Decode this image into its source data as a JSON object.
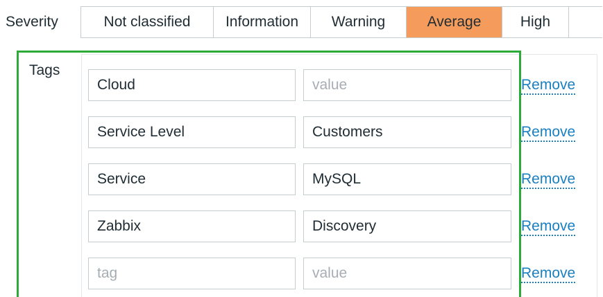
{
  "severity": {
    "label": "Severity",
    "options": [
      {
        "label": "Not classified",
        "selected": false
      },
      {
        "label": "Information",
        "selected": false
      },
      {
        "label": "Warning",
        "selected": false
      },
      {
        "label": "Average",
        "selected": true
      },
      {
        "label": "High",
        "selected": false
      },
      {
        "label": "",
        "selected": false
      }
    ],
    "selected_color": "#f59b5c"
  },
  "tags": {
    "label": "Tags",
    "highlight_color": "#2eaa38",
    "remove_label": "Remove",
    "rows": [
      {
        "tag": "Cloud",
        "tag_placeholder": "tag",
        "value": "",
        "value_placeholder": "value"
      },
      {
        "tag": "Service Level",
        "tag_placeholder": "tag",
        "value": "Customers",
        "value_placeholder": "value"
      },
      {
        "tag": "Service",
        "tag_placeholder": "tag",
        "value": "MySQL",
        "value_placeholder": "value"
      },
      {
        "tag": "Zabbix",
        "tag_placeholder": "tag",
        "value": "Discovery",
        "value_placeholder": "value"
      },
      {
        "tag": "",
        "tag_placeholder": "tag",
        "value": "",
        "value_placeholder": "value"
      }
    ]
  }
}
